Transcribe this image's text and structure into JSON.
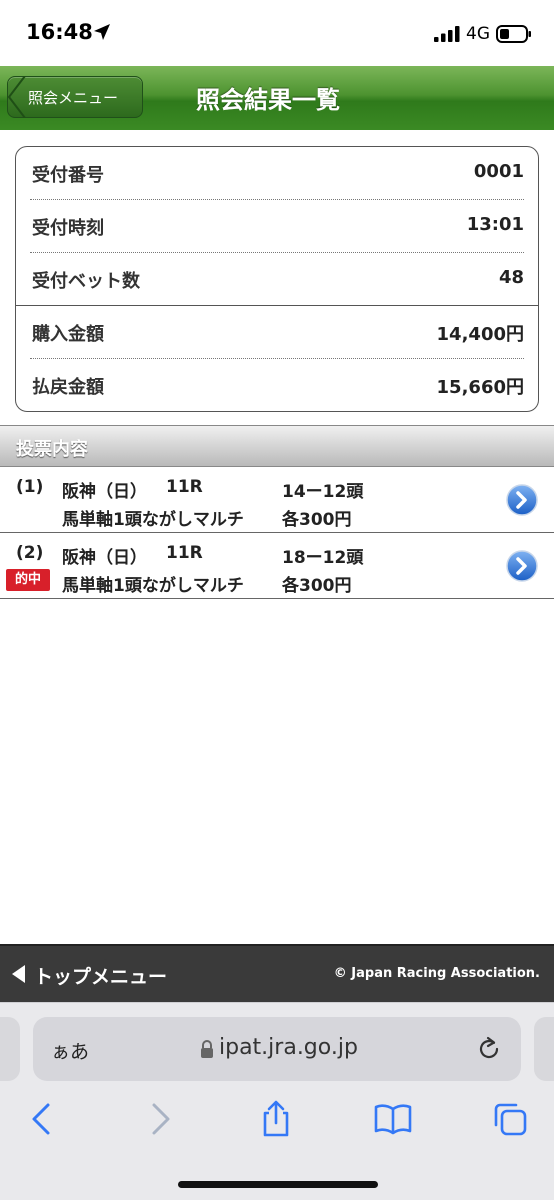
{
  "status_bar": {
    "time": "16:48",
    "network": "4G"
  },
  "header": {
    "back_label": "照会メニュー",
    "title": "照会結果一覧"
  },
  "summary": [
    {
      "label": "受付番号",
      "value": "0001"
    },
    {
      "label": "受付時刻",
      "value": "13:01"
    },
    {
      "label": "受付ベット数",
      "value": "48"
    },
    {
      "label": "購入金額",
      "value": "14,400円"
    },
    {
      "label": "払戻金額",
      "value": "15,660円"
    }
  ],
  "section": {
    "title": "投票内容"
  },
  "bets": [
    {
      "index": "(1)",
      "venue": "阪神（日）",
      "race": "11R",
      "combo": "14ー12頭",
      "bet_type": "馬単軸1頭ながしマルチ",
      "amount": "各300円",
      "hit": false
    },
    {
      "index": "(2)",
      "venue": "阪神（日）",
      "race": "11R",
      "combo": "18ー12頭",
      "bet_type": "馬単軸1頭ながしマルチ",
      "amount": "各300円",
      "hit": true,
      "hit_label": "的中"
    }
  ],
  "footer": {
    "top_menu": "トップメニュー",
    "copyright": "© Japan Racing Association."
  },
  "browser": {
    "text_size": "ぁあ",
    "url": "ipat.jra.go.jp"
  },
  "colors": {
    "header_green": "#3b8a24",
    "hit_red": "#d8202a",
    "safari_blue": "#3478f6"
  }
}
